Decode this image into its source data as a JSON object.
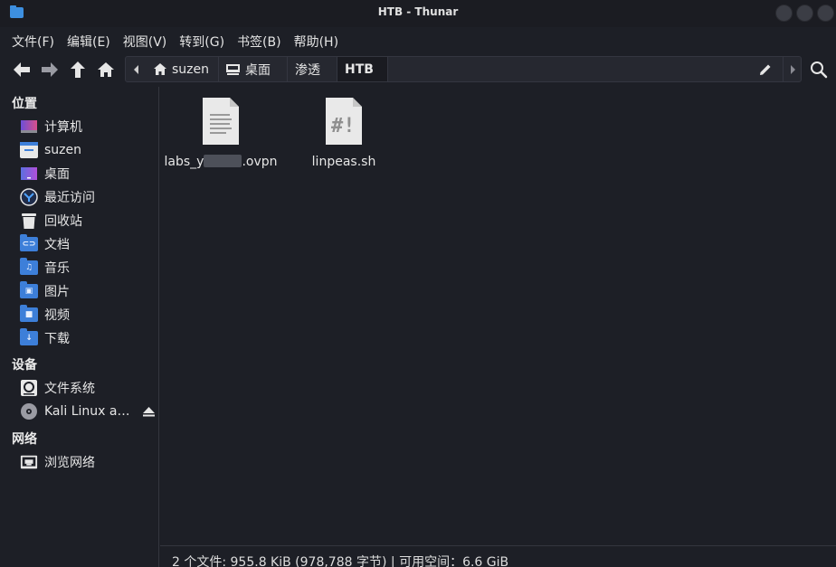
{
  "window": {
    "title": "HTB - Thunar"
  },
  "menu": [
    "文件(F)",
    "编辑(E)",
    "视图(V)",
    "转到(G)",
    "书签(B)",
    "帮助(H)"
  ],
  "path": {
    "crumbs": [
      "suzen",
      "桌面",
      "渗透",
      "HTB"
    ]
  },
  "sidebar": {
    "places_title": "位置",
    "places": [
      "计算机",
      "suzen",
      "桌面",
      "最近访问",
      "回收站",
      "文档",
      "音乐",
      "图片",
      "视频",
      "下载"
    ],
    "devices_title": "设备",
    "devices": [
      "文件系统",
      "Kali Linux am…"
    ],
    "network_title": "网络",
    "network": [
      "浏览网络"
    ]
  },
  "files": [
    {
      "name_prefix": "labs_y",
      "name_suffix": ".ovpn",
      "icon": "text-document-icon"
    },
    {
      "name": "linpeas.sh",
      "icon": "shell-script-icon"
    }
  ],
  "status": {
    "text": "2 个文件: 955.8 KiB (978,788 字节) | 可用空间：6.6 GiB"
  },
  "colors": {
    "folder_blue": "#3d7fd9",
    "background": "#1d1f26",
    "titlebar": "#1b1c22"
  }
}
